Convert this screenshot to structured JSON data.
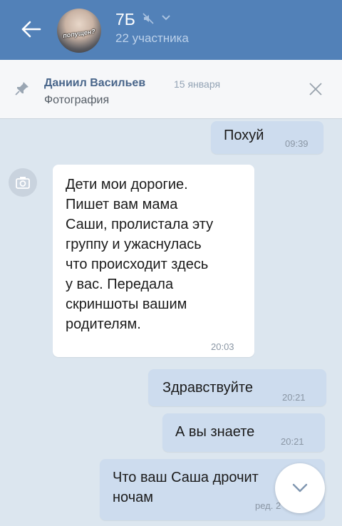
{
  "header": {
    "title": "7Б",
    "subtitle": "22 участника",
    "avatar_caption": "попущен?"
  },
  "pinned": {
    "author": "Даниил Васильев",
    "date": "15 января",
    "text": "Фотография"
  },
  "messages": [
    {
      "direction": "out",
      "text": "Похуй",
      "time": "09:39"
    },
    {
      "direction": "in",
      "text": "Дети мои дорогие.\nПишет вам мама\nСаши, пролистала эту\nгруппу и ужаснулась\nчто происходит здесь\nу вас. Передала\nскриншоты вашим\nродителям.",
      "time": "20:03"
    },
    {
      "direction": "out",
      "text": "Здравствуйте",
      "time": "20:21"
    },
    {
      "direction": "out",
      "text": "А вы знаете",
      "time": "20:21"
    },
    {
      "direction": "out",
      "text": "Что ваш Саша дрочит\nночам",
      "time": "ред. 2"
    }
  ],
  "colors": {
    "header": "#5281b8",
    "background": "#dce6ef",
    "outgoing_bubble": "#cddcee",
    "incoming_bubble": "#ffffff"
  },
  "icons": {
    "back": "arrow-left-icon",
    "mute": "muted-speaker-icon",
    "pin": "pin-icon",
    "close": "close-icon",
    "camera": "camera-icon",
    "scroll_down": "chevron-down-icon"
  }
}
